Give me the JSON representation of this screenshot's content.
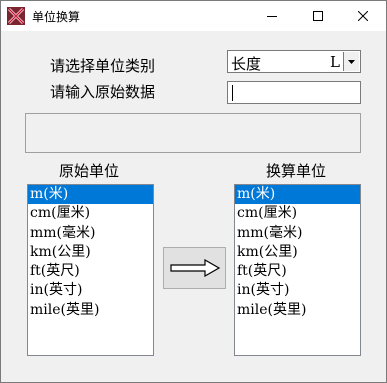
{
  "window": {
    "title": "单位换算",
    "controls": {
      "minimize": "minimize-icon",
      "maximize": "maximize-icon",
      "close": "close-icon"
    }
  },
  "form": {
    "category_label": "请选择单位类别",
    "input_label": "请输入原始数据",
    "category_value": "长度",
    "category_suffix": "L",
    "input_value": "",
    "result_value": ""
  },
  "source_list": {
    "title": "原始单位",
    "items": [
      "m(米)",
      "cm(厘米)",
      "mm(毫米)",
      "km(公里)",
      "ft(英尺)",
      "in(英寸)",
      "mile(英里)"
    ],
    "selected_index": 0
  },
  "target_list": {
    "title": "换算单位",
    "items": [
      "m(米)",
      "cm(厘米)",
      "mm(毫米)",
      "km(公里)",
      "ft(英尺)",
      "in(英寸)",
      "mile(英里)"
    ],
    "selected_index": 0
  },
  "convert_button": {
    "icon": "arrow-right-icon"
  },
  "colors": {
    "selection": "#0078d7",
    "window_bg": "#f0f0f0",
    "app_icon": "#7a2530"
  }
}
